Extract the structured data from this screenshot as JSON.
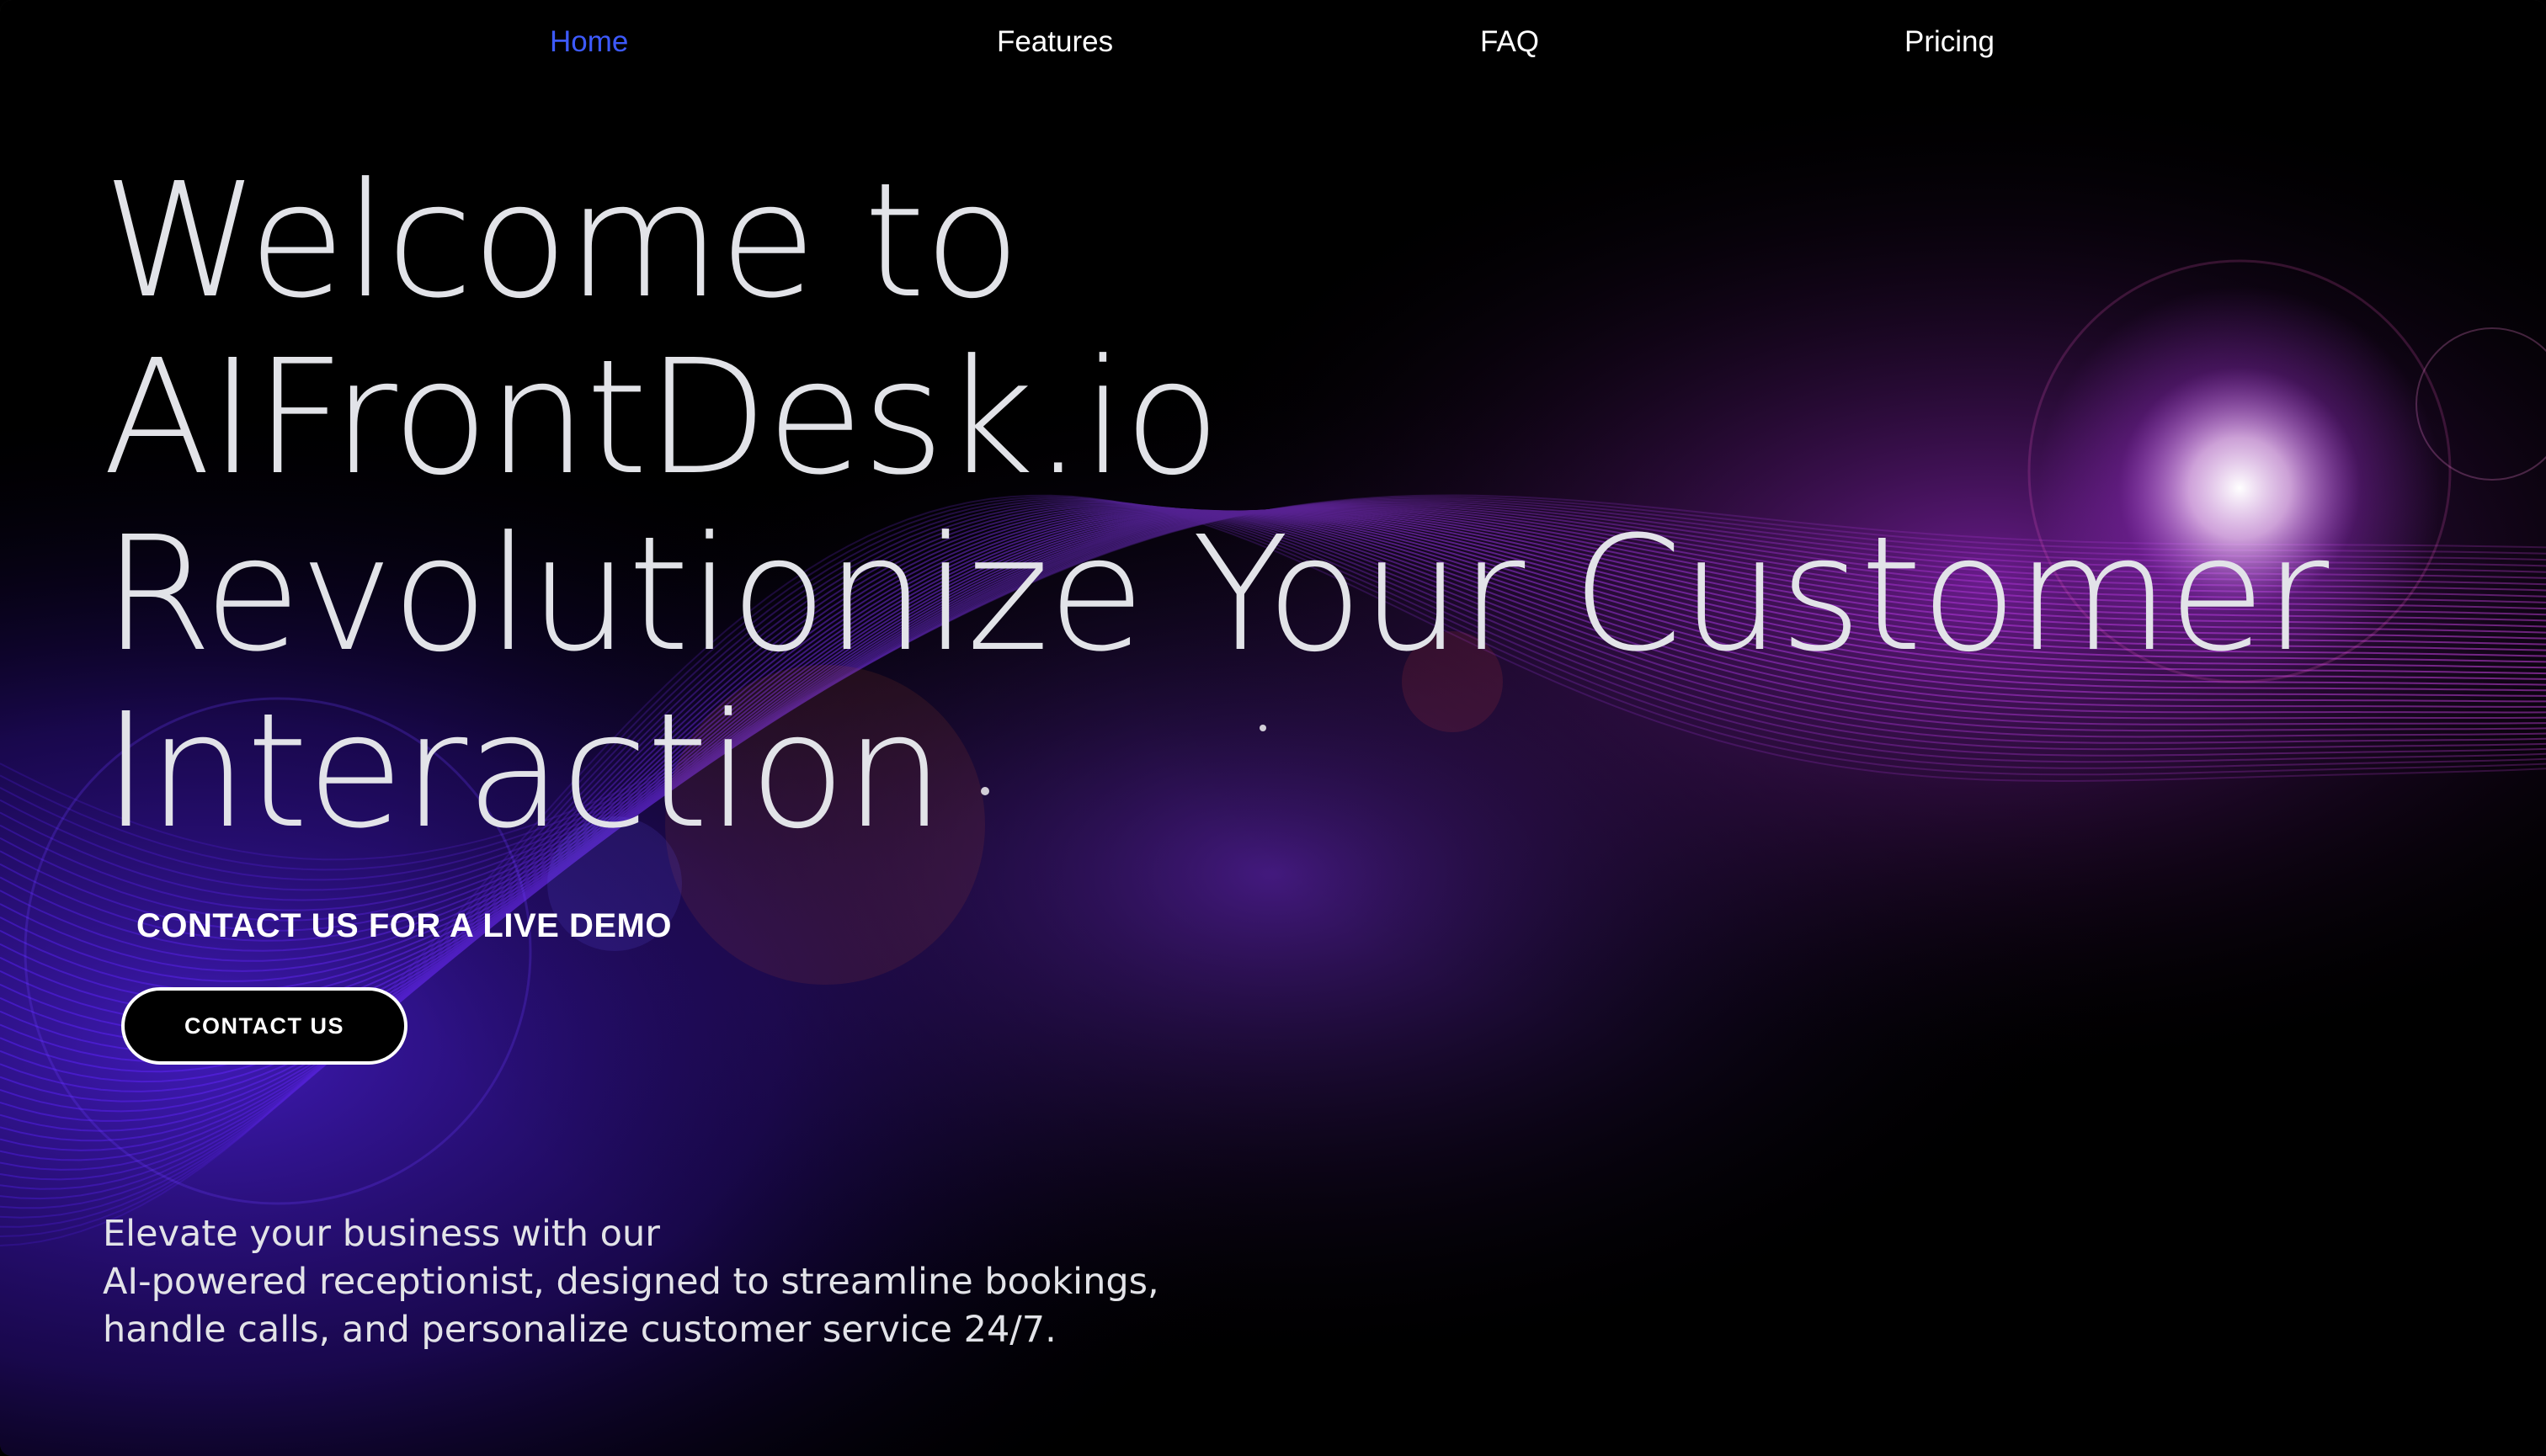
{
  "nav": {
    "items": [
      {
        "label": "Home",
        "active": true
      },
      {
        "label": "Features",
        "active": false
      },
      {
        "label": "FAQ",
        "active": false
      },
      {
        "label": "Pricing",
        "active": false
      }
    ],
    "active_color": "#3d5afe"
  },
  "hero": {
    "title_lines": [
      "Welcome to",
      "AIFrontDesk.io",
      "Revolutionize Your Customer",
      "Interaction"
    ],
    "demo_label": "CONTACT US FOR A LIVE DEMO",
    "cta_label": "CONTACT US",
    "tagline_lines": [
      "Elevate your business with our",
      "AI-powered receptionist, designed to streamline bookings,",
      "handle calls, and personalize customer service 24/7."
    ]
  },
  "theme": {
    "background": "#000000",
    "wave_primary": "#8a2be2",
    "wave_secondary": "#c13cff",
    "text": "#e2e3e8"
  }
}
